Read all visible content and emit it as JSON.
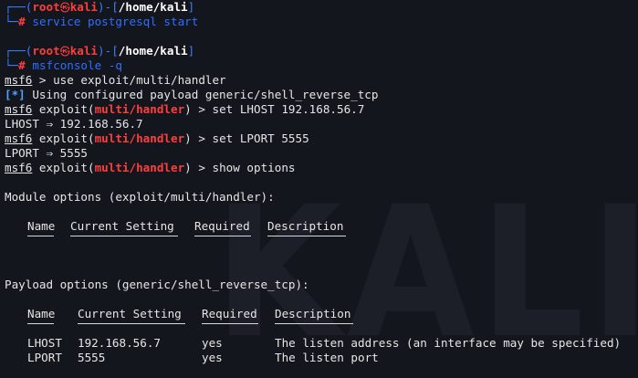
{
  "prompt1": {
    "corner_top": "┌──(",
    "user": "root",
    "host": "kali",
    "sep": ")-[",
    "path": "/home/kali",
    "close": "]",
    "corner_bottom": "└─",
    "hash": "#",
    "command": "service postgresql start"
  },
  "prompt2": {
    "corner_top": "┌──(",
    "user": "root",
    "host": "kali",
    "sep": ")-[",
    "path": "/home/kali",
    "close": "]",
    "corner_bottom": "└─",
    "hash": "#",
    "command": "msfconsole -q"
  },
  "msf": {
    "prompt": "msf6",
    "line1_cmd": " > use exploit/multi/handler",
    "info_tag": "[*]",
    "info_text": " Using configured payload generic/shell_reverse_tcp",
    "exploit_word": " exploit(",
    "module": "multi/handler",
    "exploit_close": ")",
    "cmd_lhost": " > set LHOST 192.168.56.7",
    "resp_lhost": "LHOST ⇒ 192.168.56.7",
    "cmd_lport": " > set LPORT 5555",
    "resp_lport": "LPORT ⇒ 5555",
    "cmd_show": " > show options"
  },
  "module_options": {
    "title": "Module options (exploit/multi/handler):",
    "headers": [
      "Name",
      "Current Setting",
      "Required",
      "Description"
    ]
  },
  "payload_options": {
    "title": "Payload options (generic/shell_reverse_tcp):",
    "headers": [
      "Name",
      "Current Setting",
      "Required",
      "Description"
    ],
    "rows": [
      [
        "LHOST",
        "192.168.56.7",
        "yes",
        "The listen address (an interface may be specified)"
      ],
      [
        "LPORT",
        "5555",
        "yes",
        "The listen port"
      ]
    ]
  },
  "watermark": "KALI",
  "colors": {
    "background": "#14161d",
    "prompt_blue": "#3a7bff",
    "root_red": "#ff3d3d",
    "text": "#e6e6e6"
  },
  "icons": {
    "skull": "skull-icon"
  }
}
